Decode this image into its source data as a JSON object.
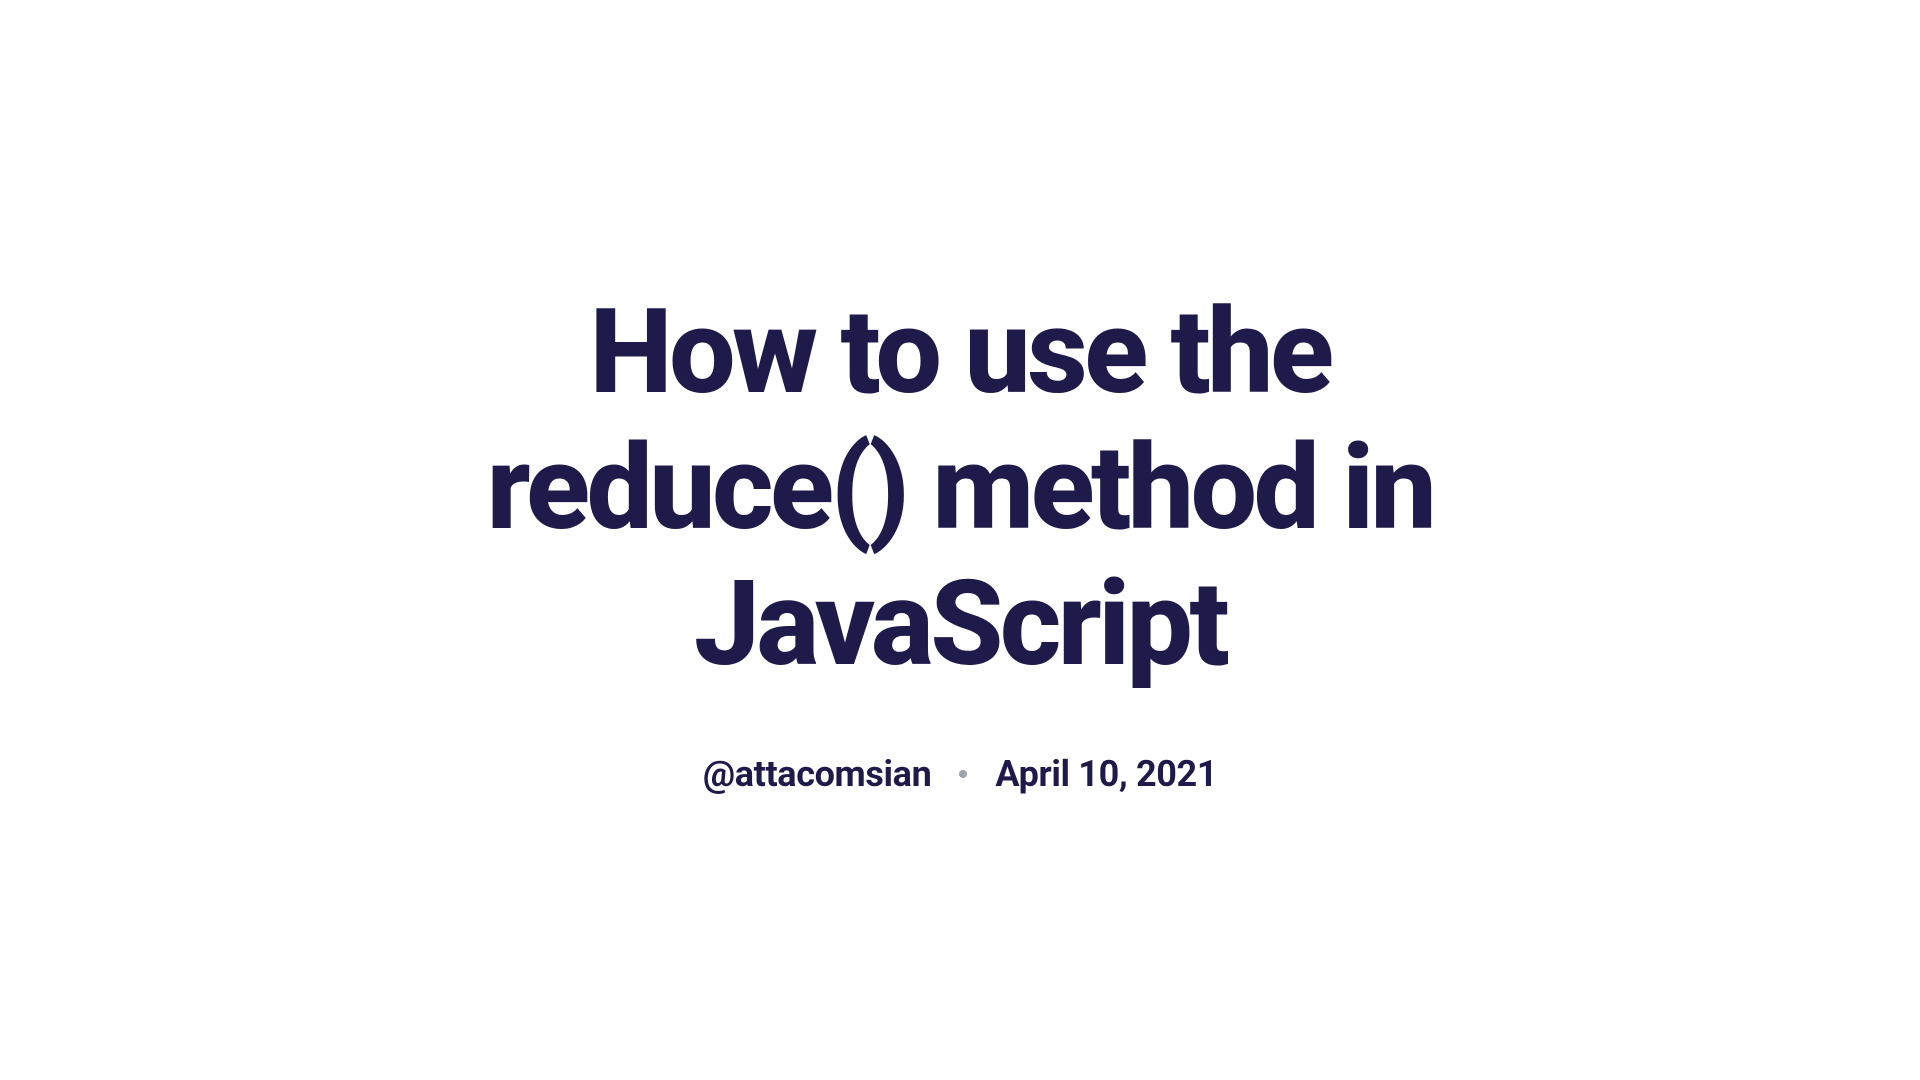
{
  "article": {
    "title": "How to use the reduce() method in JavaScript",
    "author": "@attacomsian",
    "date": "April 10, 2021"
  }
}
